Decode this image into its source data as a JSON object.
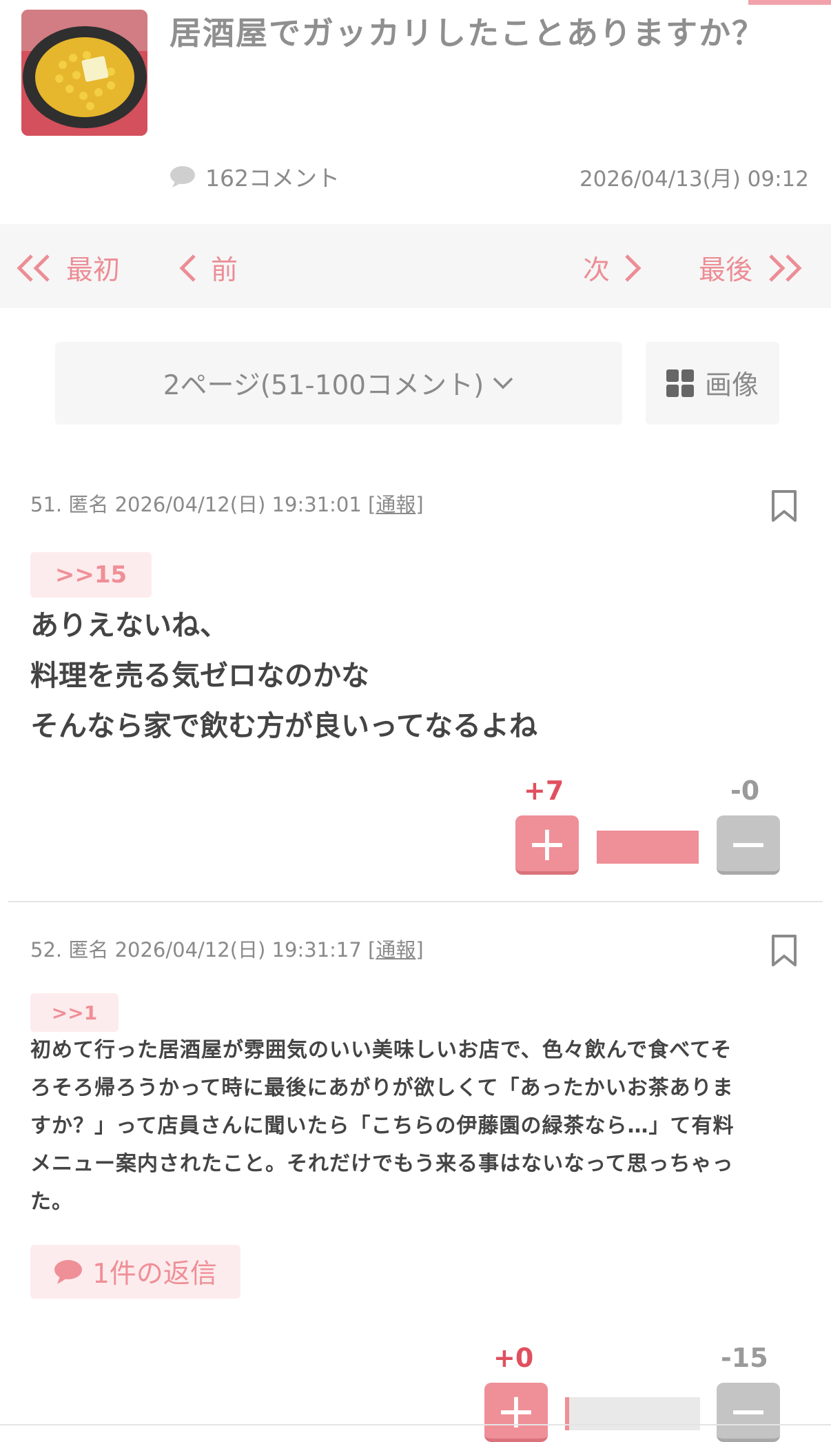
{
  "topic": {
    "title": "居酒屋でガッカリしたことありますか？",
    "comment_count": "162コメント",
    "date": "2026/04/13(月) 09:12"
  },
  "pager": {
    "first": "最初",
    "prev": "前",
    "next": "次",
    "last": "最後"
  },
  "page_select": {
    "label": "2ページ(51-100コメント)"
  },
  "image_button": {
    "label": "画像"
  },
  "comments": [
    {
      "number": "51.",
      "name": "匿名",
      "datetime": "2026/04/12(日) 19:31:01",
      "report_label": "通報",
      "anchor": ">>15",
      "body_lines": [
        "ありえないね、",
        "料理を売る気ゼロなのかな",
        "そんなら家で飲む方が良いってなるよね"
      ],
      "plus": "+7",
      "minus": "-0",
      "plus_ratio": 1.0
    },
    {
      "number": "52.",
      "name": "匿名",
      "datetime": "2026/04/12(日) 19:31:17",
      "report_label": "通報",
      "anchor": ">>1",
      "body_lines": [
        "初めて行った居酒屋が雰囲気のいい美味しいお店で、色々飲んで食べてそ",
        "ろそろ帰ろうかって時に最後にあがりが欲しくて「あったかいお茶ありま",
        "すか？」って店員さんに聞いたら「こちらの伊藤園の緑茶なら…」て有料",
        "メニュー案内されたこと。それだけでもう来る事はないなって思っちゃっ",
        "た。"
      ],
      "reply_label": "1件の返信",
      "plus": "+0",
      "minus": "-15",
      "plus_ratio": 0.03
    }
  ],
  "colors": {
    "accent": "#ef8f97",
    "plus_count": "#e0505e",
    "minus": "#c4c4c4"
  }
}
